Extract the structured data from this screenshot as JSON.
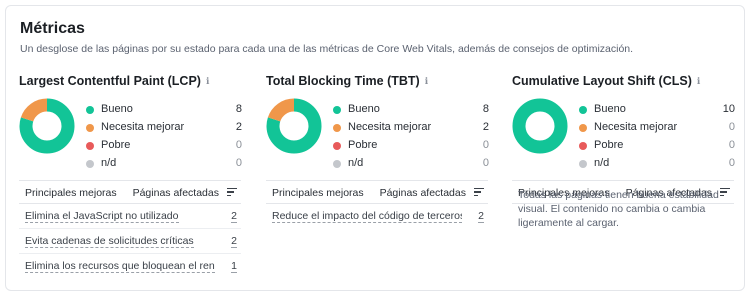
{
  "header": {
    "title": "Métricas",
    "subtitle": "Un desglose de las páginas por su estado para cada una de las métricas de Core Web Vitals, además de consejos de optimización."
  },
  "colors": {
    "good": "#12c497",
    "needs": "#f0974a",
    "poor": "#e85a5a",
    "na": "#c4c7cc"
  },
  "metrics": [
    {
      "title": "Largest Contentful Paint (LCP)",
      "info_icon": "info-icon",
      "legend": [
        {
          "label": "Bueno",
          "count": "8",
          "key": "good"
        },
        {
          "label": "Necesita mejorar",
          "count": "2",
          "key": "needs"
        },
        {
          "label": "Pobre",
          "count": "0",
          "key": "poor"
        },
        {
          "label": "n/d",
          "count": "0",
          "key": "na"
        }
      ],
      "table": {
        "col_left": "Principales mejoras",
        "col_right": "Páginas afectadas",
        "rows": [
          {
            "text": "Elimina el JavaScript no utilizado",
            "count": "2"
          },
          {
            "text": "Evita cadenas de solicitudes críticas",
            "count": "2"
          },
          {
            "text": "Elimina los recursos que bloquean el ren…",
            "count": "1"
          }
        ]
      }
    },
    {
      "title": "Total Blocking Time (TBT)",
      "info_icon": "info-icon",
      "legend": [
        {
          "label": "Bueno",
          "count": "8",
          "key": "good"
        },
        {
          "label": "Necesita mejorar",
          "count": "2",
          "key": "needs"
        },
        {
          "label": "Pobre",
          "count": "0",
          "key": "poor"
        },
        {
          "label": "n/d",
          "count": "0",
          "key": "na"
        }
      ],
      "table": {
        "col_left": "Principales mejoras",
        "col_right": "Páginas afectadas",
        "rows": [
          {
            "text": "Reduce el impacto del código de terceros",
            "count": "2"
          }
        ]
      }
    },
    {
      "title": "Cumulative Layout Shift (CLS)",
      "info_icon": "info-icon",
      "legend": [
        {
          "label": "Bueno",
          "count": "10",
          "key": "good"
        },
        {
          "label": "Necesita mejorar",
          "count": "0",
          "key": "needs"
        },
        {
          "label": "Pobre",
          "count": "0",
          "key": "poor"
        },
        {
          "label": "n/d",
          "count": "0",
          "key": "na"
        }
      ],
      "table": {
        "col_left": "Principales mejoras",
        "col_right": "Páginas afectadas",
        "note": "Todas las páginas tienen buena estabilidad visual. El contenido no cambia o cambia ligeramente al cargar."
      }
    }
  ]
}
